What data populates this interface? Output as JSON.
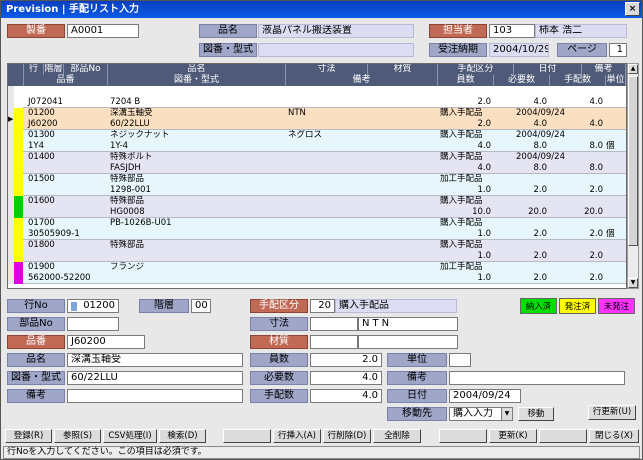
{
  "window": {
    "title": "Prevision | 手配リスト入力",
    "close": "×"
  },
  "top": {
    "seiban_label": "製番",
    "seiban_value": "A0001",
    "hinmei_label": "品名",
    "hinmei_value": "液晶パネル搬送装置",
    "tanto_label": "担当者",
    "tanto_code": "103",
    "tanto_name": "柿本 浩二",
    "zuban_label": "図番・型式",
    "zuban_value": "",
    "nouki_label": "受注納期",
    "nouki_value": "2004/10/29",
    "page_label": "ページ",
    "page_value": "1"
  },
  "grid": {
    "headers1": [
      "行",
      "階層",
      "部品No",
      "品名",
      "寸法",
      "材質",
      "手配区分",
      "日付",
      "備考"
    ],
    "headers2": [
      "品番",
      "図番・型式",
      "備考",
      "員数",
      "必要数",
      "手配数",
      "単位"
    ],
    "rows": [
      {
        "gyo": "",
        "kaiso": "",
        "buhin": "",
        "hinmei": "",
        "sunpo": "",
        "zaishitsu": "",
        "tehai": "",
        "hizuke": "",
        "biko": "",
        "hinban": "J072041",
        "zuban": "7204 B",
        "biko2": "",
        "insu": "2.0",
        "hitsuyo": "4.0",
        "tehaisu": "4.0",
        "tani": "",
        "color": "#ffffff",
        "bg": "#ffffff",
        "selected": false
      },
      {
        "gyo": "01200",
        "kaiso": "00",
        "buhin": "",
        "hinmei": "深溝玉軸受",
        "sunpo": "NTN",
        "zaishitsu": "",
        "tehai": "購入手配品",
        "hizuke": "2004/09/24",
        "biko": "",
        "hinban": "J60200",
        "zuban": "60/22LLU",
        "biko2": "",
        "insu": "2.0",
        "hitsuyo": "4.0",
        "tehaisu": "4.0",
        "tani": "",
        "color": "#ffff00",
        "bg": "#fae0c0",
        "selected": true
      },
      {
        "gyo": "01300",
        "kaiso": "00",
        "buhin": "",
        "hinmei": "ネジックナット",
        "sunpo": "ネグロス",
        "zaishitsu": "",
        "tehai": "購入手配品",
        "hizuke": "2004/09/24",
        "biko": "",
        "hinban": "1Y4",
        "zuban": "1Y-4",
        "biko2": "",
        "insu": "4.0",
        "hitsuyo": "8.0",
        "tehaisu": "8.0",
        "tani": "個",
        "color": "#ffff00",
        "bg": "#e6f6fa",
        "selected": false
      },
      {
        "gyo": "01400",
        "kaiso": "00",
        "buhin": "",
        "hinmei": "特殊ボルト",
        "sunpo": "",
        "zaishitsu": "",
        "tehai": "購入手配品",
        "hizuke": "2004/09/24",
        "biko": "",
        "hinban": "",
        "zuban": "FASJDH",
        "biko2": "",
        "insu": "4.0",
        "hitsuyo": "8.0",
        "tehaisu": "8.0",
        "tani": "",
        "color": "#ffff00",
        "bg": "#e4e4f2",
        "selected": false
      },
      {
        "gyo": "01500",
        "kaiso": "00",
        "buhin": "",
        "hinmei": "特殊部品",
        "sunpo": "",
        "zaishitsu": "",
        "tehai": "加工手配品",
        "hizuke": "",
        "biko": "",
        "hinban": "",
        "zuban": "1298-001",
        "biko2": "",
        "insu": "1.0",
        "hitsuyo": "2.0",
        "tehaisu": "2.0",
        "tani": "",
        "color": "#ffff00",
        "bg": "#e6f6fa",
        "selected": false
      },
      {
        "gyo": "01600",
        "kaiso": "00",
        "buhin": "",
        "hinmei": "特殊部品",
        "sunpo": "",
        "zaishitsu": "",
        "tehai": "購入手配品",
        "hizuke": "",
        "biko": "",
        "hinban": "",
        "zuban": "HG0008",
        "biko2": "",
        "insu": "10.0",
        "hitsuyo": "20.0",
        "tehaisu": "20.0",
        "tani": "",
        "color": "#00d000",
        "bg": "#e4e4f2",
        "selected": false
      },
      {
        "gyo": "01700",
        "kaiso": "00",
        "buhin": "",
        "hinmei": "PB-1026B-U01",
        "sunpo": "",
        "zaishitsu": "",
        "tehai": "購入手配品",
        "hizuke": "",
        "biko": "",
        "hinban": "30505909-1",
        "zuban": "",
        "biko2": "",
        "insu": "1.0",
        "hitsuyo": "2.0",
        "tehaisu": "2.0",
        "tani": "個",
        "color": "#ffff00",
        "bg": "#e6f6fa",
        "selected": false
      },
      {
        "gyo": "01800",
        "kaiso": "00",
        "buhin": "",
        "hinmei": "特殊部品",
        "sunpo": "",
        "zaishitsu": "",
        "tehai": "購入手配品",
        "hizuke": "",
        "biko": "",
        "hinban": "",
        "zuban": "",
        "biko2": "",
        "insu": "1.0",
        "hitsuyo": "2.0",
        "tehaisu": "2.0",
        "tani": "",
        "color": "#ffff00",
        "bg": "#e4e4f2",
        "selected": false
      },
      {
        "gyo": "01900",
        "kaiso": "00",
        "buhin": "",
        "hinmei": "フランジ",
        "sunpo": "",
        "zaishitsu": "",
        "tehai": "加工手配品",
        "hizuke": "",
        "biko": "",
        "hinban": "562000-52200",
        "zuban": "",
        "biko2": "",
        "insu": "1.0",
        "hitsuyo": "2.0",
        "tehaisu": "2.0",
        "tani": "",
        "color": "#e000e0",
        "bg": "#e6f6fa",
        "selected": false
      }
    ]
  },
  "detail": {
    "gyo_label": "行No",
    "gyo_value": "01200",
    "kaiso_label": "階層",
    "kaiso_value": "00",
    "tehai_label": "手配区分",
    "tehai_code": "20",
    "tehai_name": "購入手配品",
    "buhin_label": "部品No",
    "buhin_value": "",
    "sunpo_label": "寸法",
    "sunpo_value": "NTN",
    "hinban_label": "品番",
    "hinban_value": "J60200",
    "zaishitsu_label": "材質",
    "zaishitsu_value": "",
    "hinmei_label": "品名",
    "hinmei_value": "深溝玉軸受",
    "insu_label": "員数",
    "insu_value": "2.0",
    "tani_label": "単位",
    "tani_value": "",
    "zuban_label": "図番・型式",
    "zuban_value": "60/22LLU",
    "hitsuyo_label": "必要数",
    "hitsuyo_value": "4.0",
    "biko_label": "備考",
    "biko_value": "",
    "biko_label2": "備考",
    "biko_value2": "",
    "tehaisu_label": "手配数",
    "tehaisu_value": "4.0",
    "hizuke_label": "日付",
    "hizuke_value": "2004/09/24",
    "idou_label": "移動先",
    "idou_value": "購入入力",
    "idou_button": "移動",
    "update_button": "行更新(U)"
  },
  "legend": {
    "nounyu": "納入済",
    "hacchu": "発注済",
    "mihacchu": "未発注",
    "nounyu_color": "#00e000",
    "hacchu_color": "#ffff00",
    "mihacchu_color": "#ff33ff"
  },
  "buttons": {
    "b1": "登録(R)",
    "b2": "参照(S)",
    "b3": "CSV処理(I)",
    "b4": "検索(D)",
    "b5": "",
    "b6": "行挿入(A)",
    "b7": "行削除(D)",
    "b8": "全削除",
    "b9": "",
    "b10": "更新(K)",
    "b11": "",
    "b12": "閉じる(X)"
  },
  "status": "行Noを入力してください。この項目は必須です。"
}
